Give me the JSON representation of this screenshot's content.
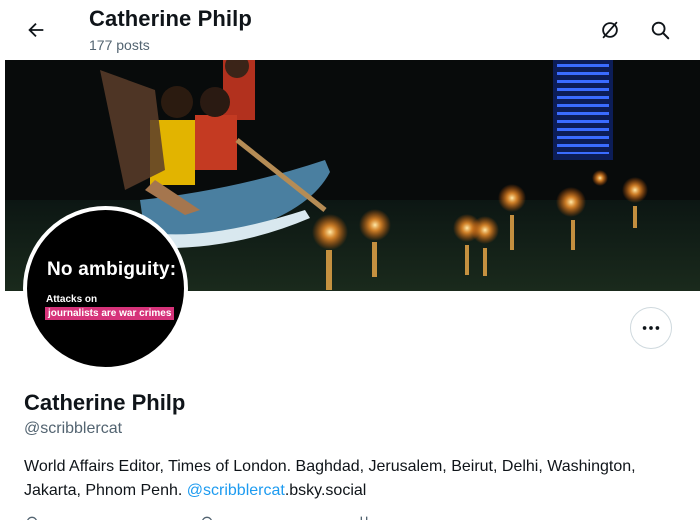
{
  "header": {
    "title": "Catherine Philp",
    "post_count": "177 posts"
  },
  "avatar": {
    "headline": "No ambiguity:",
    "line1": "Attacks on",
    "line2": "journalists are war crimes",
    "highlight_color": "#d6337a"
  },
  "profile": {
    "display_name": "Catherine Philp",
    "handle": "@scribblercat",
    "bio_text": "World Affairs Editor, Times of London. Baghdad, Jerusalem, Beirut, Delhi, Washington, Jakarta, Phnom Penh. ",
    "bio_link": "@scribblercat",
    "bio_suffix": ".bsky.social"
  },
  "colors": {
    "accent": "#1d9bf0",
    "muted": "#536471",
    "text": "#0f1419"
  },
  "icons": [
    "back-arrow-icon",
    "grok-icon",
    "search-icon",
    "more-icon",
    "location-icon",
    "link-icon",
    "calendar-icon"
  ]
}
